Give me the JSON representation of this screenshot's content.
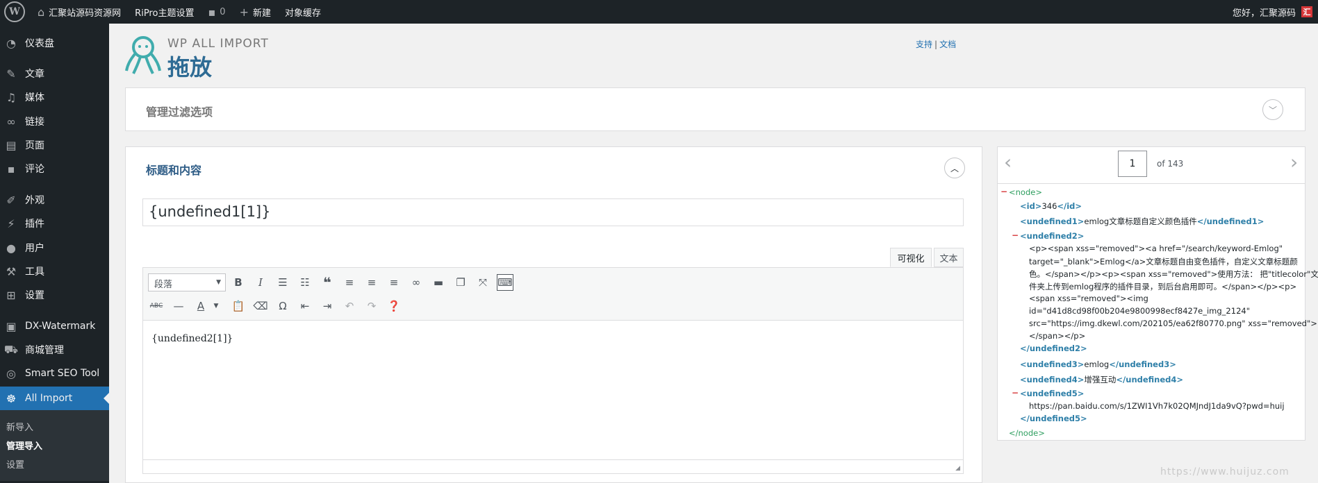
{
  "adminbar": {
    "site_name": "汇聚站源码资源网",
    "theme_settings": "RiPro主题设置",
    "comments_count": "0",
    "new_label": "新建",
    "object_cache": "对象缓存",
    "greeting": "您好，汇聚源码",
    "avatar_text": "汇"
  },
  "sidebar": {
    "items": [
      {
        "label": "仪表盘",
        "icon": "dashboard-icon"
      },
      {
        "label": "文章",
        "icon": "pin-icon"
      },
      {
        "label": "媒体",
        "icon": "media-icon"
      },
      {
        "label": "链接",
        "icon": "link-icon"
      },
      {
        "label": "页面",
        "icon": "page-icon"
      },
      {
        "label": "评论",
        "icon": "comment-icon"
      },
      {
        "label": "外观",
        "icon": "brush-icon"
      },
      {
        "label": "插件",
        "icon": "plugin-icon"
      },
      {
        "label": "用户",
        "icon": "user-icon"
      },
      {
        "label": "工具",
        "icon": "wrench-icon"
      },
      {
        "label": "设置",
        "icon": "settings-icon"
      },
      {
        "label": "DX-Watermark",
        "icon": "watermark-icon"
      },
      {
        "label": "商城管理",
        "icon": "cart-icon"
      },
      {
        "label": "Smart SEO Tool",
        "icon": "seo-icon"
      },
      {
        "label": "All Import",
        "icon": "octopus-icon"
      }
    ],
    "submenu": [
      "新导入",
      "管理导入",
      "设置"
    ]
  },
  "header": {
    "brand": "WP ALL IMPORT",
    "title": "拖放",
    "support": "支持",
    "separator": "|",
    "docs": "文档"
  },
  "filter_panel": {
    "title": "管理过滤选项"
  },
  "content_panel": {
    "title": "标题和内容",
    "title_value": "{undefined1[1]}",
    "tab_visual": "可视化",
    "tab_text": "文本",
    "format_select": "段落",
    "editor_content": "{undefined2[1]}"
  },
  "xml_panel": {
    "page": "1",
    "of": "of 143",
    "lines": {
      "node_open": "<node>",
      "id_open": "<id>",
      "id_val": "346",
      "id_close": "</id>",
      "u1_open": "<undefined1>",
      "u1_val": "emlog文章标题自定义颜色插件",
      "u1_close": "</undefined1>",
      "u2_open": "<undefined2>",
      "u2_l1": "<p><span xss=\"removed\"><a href=\"/search/keyword-Emlog\"",
      "u2_l2": "target=\"_blank\">Emlog</a>文章标题自由变色插件，自定义文章标题颜",
      "u2_l3": "色。</span></p><p><span xss=\"removed\">使用方法： 把\"titlecolor\"文",
      "u2_l4": "件夹上传到emlog程序的插件目录，到后台启用即可。</span></p><p>",
      "u2_l5": "<span xss=\"removed\"><img",
      "u2_l6": "id=\"d41d8cd98f00b204e9800998ecf8427e_img_2124\"",
      "u2_l7": "src=\"https://img.dkewl.com/202105/ea62f80770.png\" xss=\"removed\">",
      "u2_l8": "</span></p>",
      "u2_close": "</undefined2>",
      "u3_open": "<undefined3>",
      "u3_val": "emlog",
      "u3_close": "</undefined3>",
      "u4_open": "<undefined4>",
      "u4_val": "增强互动",
      "u4_close": "</undefined4>",
      "u5_open": "<undefined5>",
      "u5_val": "https://pan.baidu.com/s/1ZWI1Vh7k02QMJndJ1da9vQ?pwd=huij",
      "u5_close": "</undefined5>",
      "node_close": "</node>",
      "toggle": "−"
    }
  },
  "watermark": "https://www.huijuz.com"
}
